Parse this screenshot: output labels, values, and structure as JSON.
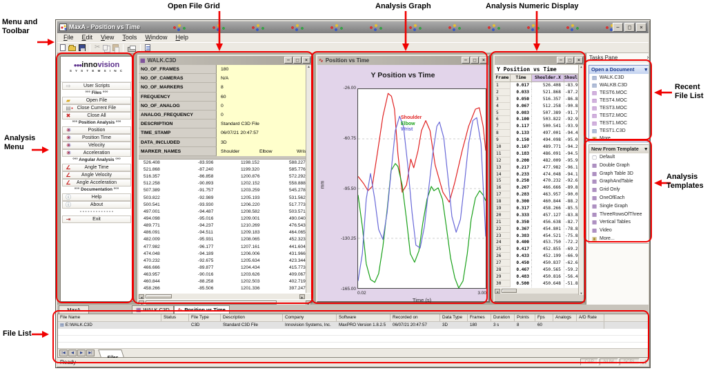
{
  "annotations": {
    "menu_toolbar": [
      "Menu and",
      "Toolbar"
    ],
    "open_file_grid": [
      "Open File Grid"
    ],
    "analysis_graph": [
      "Analysis Graph"
    ],
    "analysis_numeric": [
      "Analysis Numeric Display"
    ],
    "recent_file_list": [
      "Recent",
      "File List"
    ],
    "analysis_menu": [
      "Analysis",
      "Menu"
    ],
    "analysis_templates": [
      "Analysis",
      "Templates"
    ],
    "file_list": [
      "File List"
    ]
  },
  "titlebar": {
    "title": "MaxA - Position vs Time"
  },
  "menubar": {
    "items": [
      "File",
      "Edit",
      "View",
      "Tools",
      "Window",
      "Help"
    ]
  },
  "toolbar": {
    "buttons": [
      "new-file-icon",
      "open-file-icon",
      "save-icon",
      "cut-icon",
      "copy-icon",
      "paste-icon",
      "print-icon",
      "document-icon"
    ]
  },
  "sidebar": {
    "logo": {
      "dots": "●●●",
      "brand_a": "inno",
      "brand_b": "vision",
      "subtitle": "S Y S T E M S   I N C"
    },
    "items": [
      {
        "label": "User Scripts",
        "type": "button",
        "icon": "arrow-icon"
      },
      {
        "label": "°°° Files °°°",
        "type": "section",
        "icon": ""
      },
      {
        "label": "Open File",
        "type": "button",
        "icon": "open-folder-icon"
      },
      {
        "label": "Close Current File",
        "type": "button",
        "icon": "close-file-icon"
      },
      {
        "label": "Close All",
        "type": "button",
        "icon": "close-all-icon"
      },
      {
        "label": "°°° Position Analysis °°°",
        "type": "section",
        "icon": ""
      },
      {
        "label": "Position",
        "type": "button",
        "icon": "motion-icon"
      },
      {
        "label": "Position Time",
        "type": "button",
        "icon": "motion-icon"
      },
      {
        "label": "Velocity",
        "type": "button",
        "icon": "motion-icon"
      },
      {
        "label": "Acceleration",
        "type": "button",
        "icon": "motion-icon"
      },
      {
        "label": "°°° Angular Analysis °°°",
        "type": "section",
        "icon": ""
      },
      {
        "label": "Angle Time",
        "type": "button",
        "icon": "angle-icon"
      },
      {
        "label": "Angle Velocity",
        "type": "button",
        "icon": "angle-icon"
      },
      {
        "label": "Angle Acceleration",
        "type": "button",
        "icon": "angle-icon"
      },
      {
        "label": "°°° Documentation °°°",
        "type": "section",
        "icon": ""
      },
      {
        "label": "Help",
        "type": "button",
        "icon": "info-icon"
      },
      {
        "label": "About",
        "type": "button",
        "icon": "info-icon"
      },
      {
        "label": "- - - - - - - - - - - - -",
        "type": "section",
        "icon": ""
      },
      {
        "label": "Exit",
        "type": "button",
        "icon": "exit-icon"
      }
    ]
  },
  "grid_window": {
    "title": "WALK.C3D",
    "parameters": [
      {
        "name": "NO_OF_FRAMES",
        "value": "180"
      },
      {
        "name": "NO_OF_CAMERAS",
        "value": "N/A"
      },
      {
        "name": "NO_OF_MARKERS",
        "value": "8"
      },
      {
        "name": "FREQUENCY",
        "value": "60"
      },
      {
        "name": "NO_OF_ANALOG",
        "value": "0"
      },
      {
        "name": "ANALOG_FREQUENCY",
        "value": "0"
      },
      {
        "name": "DESCRIPTION",
        "value": "Standard C3D File"
      },
      {
        "name": "TIME_STAMP",
        "value": "06/07/21 20:47:57"
      },
      {
        "name": "DATA_INCLUDED",
        "value": "3D"
      }
    ],
    "marker_row": {
      "name": "MARKER_NAMES",
      "values": [
        "Shoulder",
        "Elbow",
        "Wrist"
      ]
    },
    "rows": [
      [
        "526.408",
        "-83.936",
        "1198.152",
        "588.227"
      ],
      [
        "521.868",
        "-87.240",
        "1199.320",
        "585.776"
      ],
      [
        "516.357",
        "-86.858",
        "1200.876",
        "572.292"
      ],
      [
        "512.258",
        "-90.893",
        "1202.152",
        "558.888"
      ],
      [
        "507.389",
        "-91.757",
        "1203.259",
        "545.278"
      ],
      [
        "503.822",
        "-92.989",
        "1205.193",
        "531.562"
      ],
      [
        "500.541",
        "-93.930",
        "1206.220",
        "517.773"
      ],
      [
        "497.001",
        "-94.487",
        "1208.582",
        "503.571"
      ],
      [
        "494.098",
        "-95.016",
        "1209.001",
        "490.040"
      ],
      [
        "489.771",
        "-94.237",
        "1210.269",
        "476.543"
      ],
      [
        "486.091",
        "-94.511",
        "1209.183",
        "464.065"
      ],
      [
        "482.009",
        "-95.931",
        "1208.065",
        "452.323"
      ],
      [
        "477.982",
        "-96.177",
        "1207.161",
        "441.604"
      ],
      [
        "474.048",
        "-94.189",
        "1206.006",
        "431.966"
      ],
      [
        "470.232",
        "-92.675",
        "1205.634",
        "423.344"
      ],
      [
        "466.666",
        "-89.877",
        "1204.434",
        "415.773"
      ],
      [
        "463.957",
        "-90.016",
        "1203.626",
        "409.067"
      ],
      [
        "460.844",
        "-88.258",
        "1202.503",
        "402.719"
      ],
      [
        "458.266",
        "-85.506",
        "1201.336",
        "397.247"
      ]
    ]
  },
  "graph_window": {
    "title": "Position vs Time"
  },
  "chart_data": {
    "type": "line",
    "title": "Y Position vs Time",
    "xlabel": "Time (s)",
    "ylabel": "mm",
    "xlim": [
      0.02,
      3.0
    ],
    "ylim": [
      -165.0,
      -26.0
    ],
    "yticks": [
      "-26.00",
      "-60.75",
      "-95.50",
      "-130.25",
      "-165.00"
    ],
    "xticks": [
      "0.02",
      "3.00"
    ],
    "gridlines": [
      -60.75,
      -95.5,
      -130.25
    ],
    "legend_position": "top-left",
    "series": [
      {
        "name": "Shoulder",
        "color": "#e02020",
        "t": [
          0.02,
          0.15,
          0.25,
          0.35,
          0.47,
          0.6,
          0.72,
          0.8,
          0.87,
          0.95,
          1.05,
          1.15,
          1.25,
          1.32,
          1.42,
          1.5,
          1.6,
          1.7,
          1.82,
          2.0,
          2.15,
          2.28,
          2.45,
          2.6,
          2.76,
          2.85,
          2.94,
          3.0
        ],
        "y": [
          -87,
          -92,
          -97,
          -94,
          -71,
          -45,
          -29,
          -31,
          -40,
          -71,
          -98,
          -93,
          -75,
          -81,
          -69,
          -55,
          -48,
          -55,
          -79,
          -98,
          -105,
          -91,
          -69,
          -52,
          -40,
          -39,
          -52,
          -69
        ]
      },
      {
        "name": "Elbow",
        "color": "#18a018",
        "t": [
          0.02,
          0.12,
          0.21,
          0.31,
          0.41,
          0.5,
          0.6,
          0.7,
          0.79,
          0.89,
          0.95,
          1.05,
          1.15,
          1.24,
          1.34,
          1.44,
          1.53,
          1.63,
          1.73,
          1.79,
          1.89,
          1.99,
          2.08,
          2.18,
          2.28,
          2.37,
          2.47,
          2.57,
          2.66,
          2.76,
          2.86,
          2.94,
          3.0
        ],
        "y": [
          -100,
          -122,
          -148,
          -159,
          -161,
          -155,
          -136,
          -110,
          -83,
          -78,
          -80,
          -93,
          -117,
          -141,
          -147,
          -139,
          -120,
          -103,
          -94,
          -97,
          -95,
          -103,
          -122,
          -144,
          -158,
          -165,
          -160,
          -141,
          -117,
          -102,
          -97,
          -100,
          -104
        ]
      },
      {
        "name": "Wrist",
        "color": "#6868d8",
        "t": [
          0.02,
          0.12,
          0.21,
          0.31,
          0.41,
          0.5,
          0.6,
          0.7,
          0.79,
          0.89,
          0.99,
          1.08,
          1.18,
          1.28,
          1.37,
          1.47,
          1.57,
          1.66,
          1.76,
          1.86,
          1.92,
          2.02,
          2.12,
          2.21,
          2.31,
          2.41,
          2.5,
          2.6,
          2.7,
          2.79,
          2.89,
          3.0
        ],
        "y": [
          -160,
          -141,
          -103,
          -85,
          -103,
          -124,
          -131,
          -112,
          -84,
          -55,
          -45,
          -52,
          -79,
          -112,
          -135,
          -137,
          -122,
          -98,
          -72,
          -52,
          -49,
          -60,
          -88,
          -115,
          -126,
          -117,
          -93,
          -64,
          -48,
          -46,
          -64,
          -129
        ]
      }
    ]
  },
  "numeric_window": {
    "title": "Y Position vs Time",
    "columns": [
      "Frame",
      "Time",
      "Shoulder.X",
      "Shoulder"
    ],
    "rows": [
      [
        "1",
        "0.017",
        "526.408",
        "-83.9"
      ],
      [
        "2",
        "0.033",
        "521.868",
        "-87.2"
      ],
      [
        "3",
        "0.050",
        "516.357",
        "-86.8"
      ],
      [
        "4",
        "0.067",
        "512.258",
        "-90.8"
      ],
      [
        "5",
        "0.083",
        "507.389",
        "-91.7"
      ],
      [
        "6",
        "0.100",
        "503.822",
        "-92.9"
      ],
      [
        "7",
        "0.117",
        "500.541",
        "-93.9"
      ],
      [
        "8",
        "0.133",
        "497.001",
        "-94.4"
      ],
      [
        "9",
        "0.150",
        "494.098",
        "-95.0"
      ],
      [
        "10",
        "0.167",
        "489.771",
        "-94.2"
      ],
      [
        "11",
        "0.183",
        "486.091",
        "-94.5"
      ],
      [
        "12",
        "0.200",
        "482.009",
        "-95.9"
      ],
      [
        "13",
        "0.217",
        "477.982",
        "-96.1"
      ],
      [
        "14",
        "0.233",
        "474.048",
        "-94.1"
      ],
      [
        "15",
        "0.250",
        "470.232",
        "-92.6"
      ],
      [
        "16",
        "0.267",
        "466.666",
        "-89.8"
      ],
      [
        "17",
        "0.283",
        "463.957",
        "-90.0"
      ],
      [
        "18",
        "0.300",
        "460.844",
        "-88.2"
      ],
      [
        "19",
        "0.317",
        "458.266",
        "-85.5"
      ],
      [
        "20",
        "0.333",
        "457.127",
        "-83.8"
      ],
      [
        "21",
        "0.350",
        "456.638",
        "-82.7"
      ],
      [
        "22",
        "0.367",
        "454.801",
        "-78.8"
      ],
      [
        "23",
        "0.383",
        "454.521",
        "-75.8"
      ],
      [
        "24",
        "0.400",
        "453.750",
        "-72.2"
      ],
      [
        "25",
        "0.417",
        "452.855",
        "-69.2"
      ],
      [
        "26",
        "0.433",
        "452.199",
        "-66.9"
      ],
      [
        "27",
        "0.450",
        "450.837",
        "-62.6"
      ],
      [
        "28",
        "0.467",
        "450.565",
        "-59.2"
      ],
      [
        "29",
        "0.483",
        "450.816",
        "-56.4"
      ],
      [
        "30",
        "0.500",
        "450.648",
        "-51.8"
      ]
    ]
  },
  "tasks_pane": {
    "title": "Tasks Pane",
    "open_document": {
      "header": "Open a Document",
      "items": [
        {
          "label": "WALK.C3D",
          "icon": "c3d-file-icon"
        },
        {
          "label": "WALKB.C3D",
          "icon": "c3d-file-icon"
        },
        {
          "label": "TEST6.MOC",
          "icon": "moc-file-icon"
        },
        {
          "label": "TEST4.MOC",
          "icon": "moc-file-icon"
        },
        {
          "label": "TEST3.MOC",
          "icon": "moc-file-icon"
        },
        {
          "label": "TEST2.MOC",
          "icon": "moc-file-icon"
        },
        {
          "label": "TEST1.MOC",
          "icon": "moc-file-icon"
        },
        {
          "label": "TEST1.C3D",
          "icon": "c3d-file-icon"
        },
        {
          "label": "More...",
          "icon": "more-icon"
        }
      ]
    },
    "templates": {
      "header": "New From Template",
      "items": [
        {
          "label": "Default",
          "icon": "default-template-icon"
        },
        {
          "label": "Double Graph",
          "icon": "template-icon"
        },
        {
          "label": "Graph Table 3D",
          "icon": "template-icon"
        },
        {
          "label": "GraphAndTable",
          "icon": "template-icon"
        },
        {
          "label": "Grid Only",
          "icon": "template-icon"
        },
        {
          "label": "OneOfEach",
          "icon": "template-icon"
        },
        {
          "label": "Single Graph",
          "icon": "template-icon"
        },
        {
          "label": "ThreeRowsOfThree",
          "icon": "template-icon"
        },
        {
          "label": "Vertical Tables",
          "icon": "template-icon"
        },
        {
          "label": "Video",
          "icon": "template-icon"
        },
        {
          "label": "More...",
          "icon": "more-icon"
        }
      ]
    }
  },
  "tab_strip": {
    "left_tab": "MaxA",
    "tabs": [
      "WALK.C3D",
      "Position vs Time"
    ]
  },
  "file_list": {
    "columns": [
      "File Name",
      "Status",
      "File Type",
      "Description",
      "Company",
      "Software",
      "Recorded on",
      "Data Type",
      "Frames",
      "Duration",
      "Points",
      "Fps",
      "Analogs",
      "A/D Rate"
    ],
    "row": [
      "E:\\WALK.C3D",
      "",
      "C3D",
      "Standard C3D File",
      "Innovision Systems, Inc.",
      "MaxPRO Version 1.8.2.5",
      "06/07/21 20:47:57",
      "3D",
      "180",
      "3 s",
      "8",
      "60",
      "",
      ""
    ],
    "nav_tab": "Files"
  },
  "status_bar": {
    "text": "Ready",
    "indicators": [
      "CAP",
      "NUM",
      "SCRL"
    ]
  }
}
